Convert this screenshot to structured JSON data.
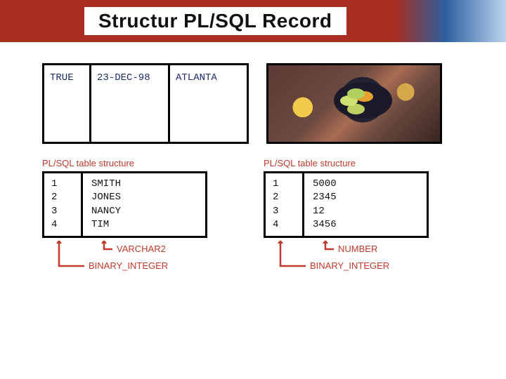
{
  "title": "Structur PL/SQL Record",
  "record": {
    "cell1": "TRUE",
    "cell2": "23-DEC-98",
    "cell3": "ATLANTA"
  },
  "table_caption": "PL/SQL table structure",
  "left_table": {
    "idx": [
      "1",
      "2",
      "3",
      "4"
    ],
    "val": [
      "SMITH",
      "JONES",
      "NANCY",
      "TIM"
    ],
    "value_type": "VARCHAR2",
    "index_type": "BINARY_INTEGER"
  },
  "right_table": {
    "idx": [
      "1",
      "2",
      "3",
      "4"
    ],
    "val": [
      "5000",
      "2345",
      "12",
      "3456"
    ],
    "value_type": "NUMBER",
    "index_type": "BINARY_INTEGER"
  }
}
